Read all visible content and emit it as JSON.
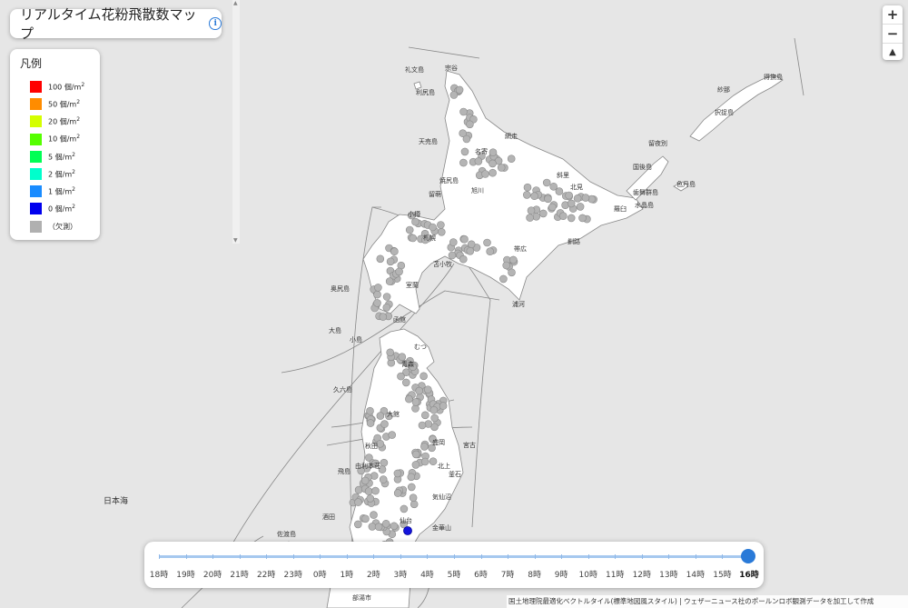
{
  "title": "リアルタイム花粉飛散数マップ",
  "info_icon": "info-icon",
  "legend": {
    "title": "凡例",
    "items": [
      {
        "label": "100 個/m",
        "color": "#ff0000"
      },
      {
        "label": "50 個/m",
        "color": "#ff8c00"
      },
      {
        "label": "20 個/m",
        "color": "#d4ff00"
      },
      {
        "label": "10 個/m",
        "color": "#55ff00"
      },
      {
        "label": "5 個/m",
        "color": "#00ff55"
      },
      {
        "label": "2 個/m",
        "color": "#00ffcc"
      },
      {
        "label": "1 個/m",
        "color": "#1a8cff"
      },
      {
        "label": "0 個/m",
        "color": "#0000ee"
      },
      {
        "label": "（欠測）",
        "color": "#b0b0b0"
      }
    ],
    "unit_superscript": "2"
  },
  "zoom": {
    "in": "+",
    "out": "−",
    "compass": "▲"
  },
  "timeline": {
    "hours": [
      "18時",
      "19時",
      "20時",
      "21時",
      "22時",
      "23時",
      "0時",
      "1時",
      "2時",
      "3時",
      "4時",
      "5時",
      "6時",
      "7時",
      "8時",
      "9時",
      "10時",
      "11時",
      "12時",
      "13時",
      "14時",
      "15時",
      "16時"
    ],
    "selected": "16時"
  },
  "attribution": "国土地理院最適化ベクトルタイル(標準地図風スタイル) | ウェザーニュース社のポールンロボ観測データを加工して作成",
  "sea_label": "日本海",
  "places": [
    {
      "name": "礼文島"
    },
    {
      "name": "利尻島"
    },
    {
      "name": "天売島"
    },
    {
      "name": "焼尻島"
    },
    {
      "name": "留萌"
    },
    {
      "name": "旭川"
    },
    {
      "name": "北見"
    },
    {
      "name": "網走"
    },
    {
      "name": "小樽"
    },
    {
      "name": "札幌"
    },
    {
      "name": "帯広"
    },
    {
      "name": "釧路"
    },
    {
      "name": "苫小牧"
    },
    {
      "name": "室蘭"
    },
    {
      "name": "浦河"
    },
    {
      "name": "函館"
    },
    {
      "name": "奥尻島"
    },
    {
      "name": "大島"
    },
    {
      "name": "小島"
    },
    {
      "name": "むつ"
    },
    {
      "name": "青森"
    },
    {
      "name": "久六島"
    },
    {
      "name": "大館"
    },
    {
      "name": "秋田"
    },
    {
      "name": "宮古"
    },
    {
      "name": "盛岡"
    },
    {
      "name": "飛島"
    },
    {
      "name": "由利本荘"
    },
    {
      "name": "北上"
    },
    {
      "name": "釜石"
    },
    {
      "name": "気仙沼"
    },
    {
      "name": "酒田"
    },
    {
      "name": "仙台"
    },
    {
      "name": "金華山"
    },
    {
      "name": "佐渡島"
    },
    {
      "name": "部湯市"
    },
    {
      "name": "国後島"
    },
    {
      "name": "色丹島"
    },
    {
      "name": "択捉島"
    },
    {
      "name": "留夜別"
    },
    {
      "name": "歯舞群島"
    },
    {
      "name": "水晶島"
    },
    {
      "name": "紗那"
    },
    {
      "name": "得撫島"
    },
    {
      "name": "斜里"
    },
    {
      "name": "名寄"
    },
    {
      "name": "羅臼"
    },
    {
      "name": "宗谷"
    }
  ]
}
